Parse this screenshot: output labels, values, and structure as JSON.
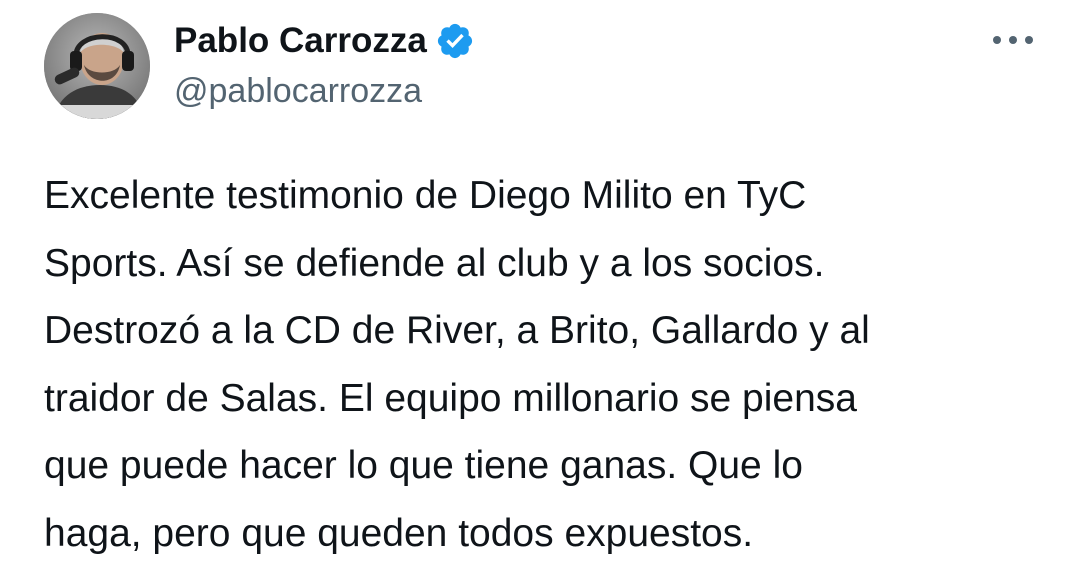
{
  "author": {
    "display_name": "Pablo Carrozza",
    "handle": "@pablocarrozza",
    "verified": true,
    "verified_icon": "verified-badge-icon",
    "verified_color": "#1d9bf0",
    "avatar_icon": "user-avatar"
  },
  "menu": {
    "icon": "more-options-icon"
  },
  "tweet": {
    "text": "Excelente testimonio de Diego Milito en TyC\nSports. Así se defiende al club y a los socios.\nDestrozó a la CD de River, a Brito, Gallardo y al\ntraidor de Salas. El equipo millonario se piensa\nque puede hacer lo que tiene ganas. Que lo\nhaga, pero que queden todos expuestos."
  },
  "colors": {
    "text_primary": "#0f1419",
    "text_secondary": "#536471",
    "background": "#ffffff"
  }
}
